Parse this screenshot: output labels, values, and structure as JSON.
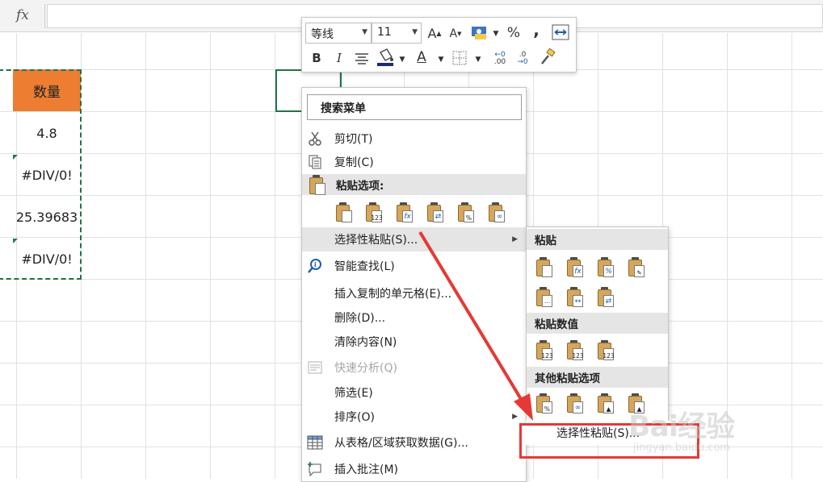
{
  "formula_bar": {
    "fx_label": "fx"
  },
  "sheet": {
    "header": "数量",
    "values": [
      "4.8",
      "#DIV/0!",
      "25.39683",
      "#DIV/0!"
    ]
  },
  "mini_toolbar": {
    "font_name": "等线",
    "font_size": "11",
    "grow_font": "A",
    "shrink_font": "A",
    "percent": "%",
    "comma": ",",
    "bold": "B",
    "italic": "I",
    "font_color": "A",
    "inc_decimal": ".00",
    "dec_decimal": ".0"
  },
  "context_menu": {
    "search_label": "搜索菜单",
    "cut": "剪切(T)",
    "copy": "复制(C)",
    "paste_options": "粘贴选项:",
    "paste_special": "选择性粘贴(S)...",
    "smart_lookup": "智能查找(L)",
    "insert_copied": "插入复制的单元格(E)...",
    "delete": "删除(D)...",
    "clear": "清除内容(N)",
    "quick_analysis": "快速分析(Q)",
    "filter": "筛选(E)",
    "sort": "排序(O)",
    "get_data": "从表格/区域获取数据(G)...",
    "insert_comment": "插入批注(M)"
  },
  "submenu": {
    "paste": "粘贴",
    "paste_values": "粘贴数值",
    "other_paste": "其他粘贴选项",
    "paste_special": "选择性粘贴(S)..."
  },
  "watermark": {
    "brand": "Bai经验",
    "url": "jingyan.baidu.com"
  },
  "colors": {
    "accent_header": "#ed7d31",
    "selection": "#217346",
    "highlight_box": "#e53935",
    "arrow": "#e53935"
  }
}
